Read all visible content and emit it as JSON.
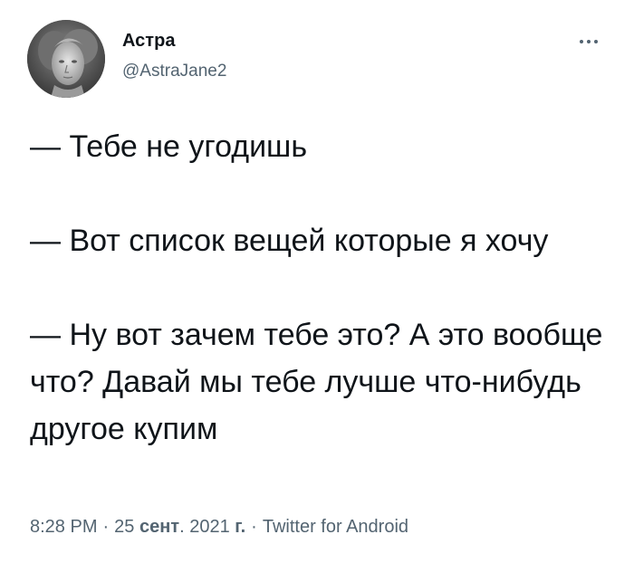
{
  "author": {
    "display_name": "Астра",
    "handle": "@AstraJane2",
    "avatar_icon": "statue-portrait-avatar"
  },
  "more_icon": "more-horizontal-icon",
  "tweet": {
    "lines": [
      "— Тебе не угодишь",
      "— Вот список вещей которые я хочу",
      "— Ну вот зачем тебе это? А это вообще что? Давай мы тебе лучше что-нибудь другое купим"
    ]
  },
  "meta": {
    "time": "8:28 PM",
    "sep1": "·",
    "day": "25",
    "month": "сент",
    "year": "2021",
    "year_suffix": "г.",
    "sep2": "·",
    "source": "Twitter for Android"
  },
  "colors": {
    "text": "#0f1419",
    "secondary": "#536471",
    "background": "#ffffff"
  }
}
